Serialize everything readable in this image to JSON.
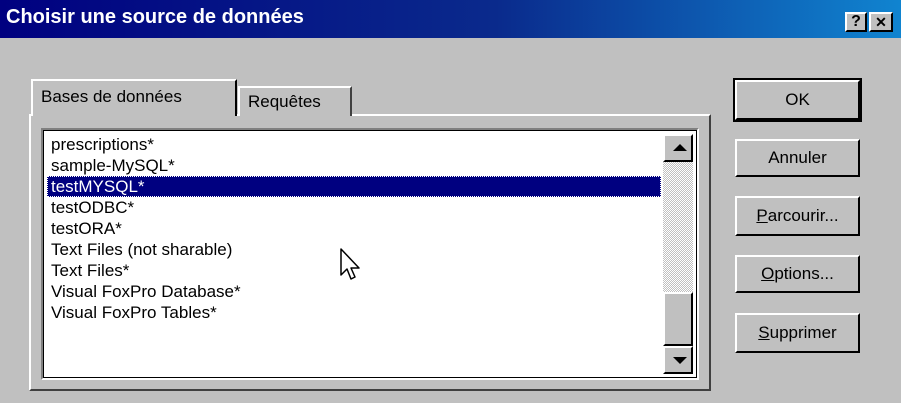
{
  "window": {
    "title": "Choisir une source de données",
    "help_label": "?",
    "close_label": "✕"
  },
  "tabs": [
    {
      "label": "Bases de données",
      "active": true
    },
    {
      "label": "Requêtes",
      "active": false
    }
  ],
  "list": {
    "items": [
      {
        "label": "prescriptions*",
        "selected": false
      },
      {
        "label": "sample-MySQL*",
        "selected": false
      },
      {
        "label": "testMYSQL*",
        "selected": true
      },
      {
        "label": "testODBC*",
        "selected": false
      },
      {
        "label": "testORA*",
        "selected": false
      },
      {
        "label": "Text Files (not sharable)",
        "selected": false
      },
      {
        "label": "Text Files*",
        "selected": false
      },
      {
        "label": "Visual FoxPro Database*",
        "selected": false
      },
      {
        "label": "Visual FoxPro Tables*",
        "selected": false
      }
    ]
  },
  "buttons": {
    "ok": "OK",
    "cancel": "Annuler",
    "browse": {
      "mnemonic": "P",
      "rest": "arcourir..."
    },
    "options": {
      "mnemonic": "O",
      "rest": "ptions..."
    },
    "delete": {
      "mnemonic": "S",
      "rest": "upprimer"
    }
  },
  "colors": {
    "title_bar": "#000080",
    "selection": "#000080",
    "face": "#c0c0c0"
  }
}
